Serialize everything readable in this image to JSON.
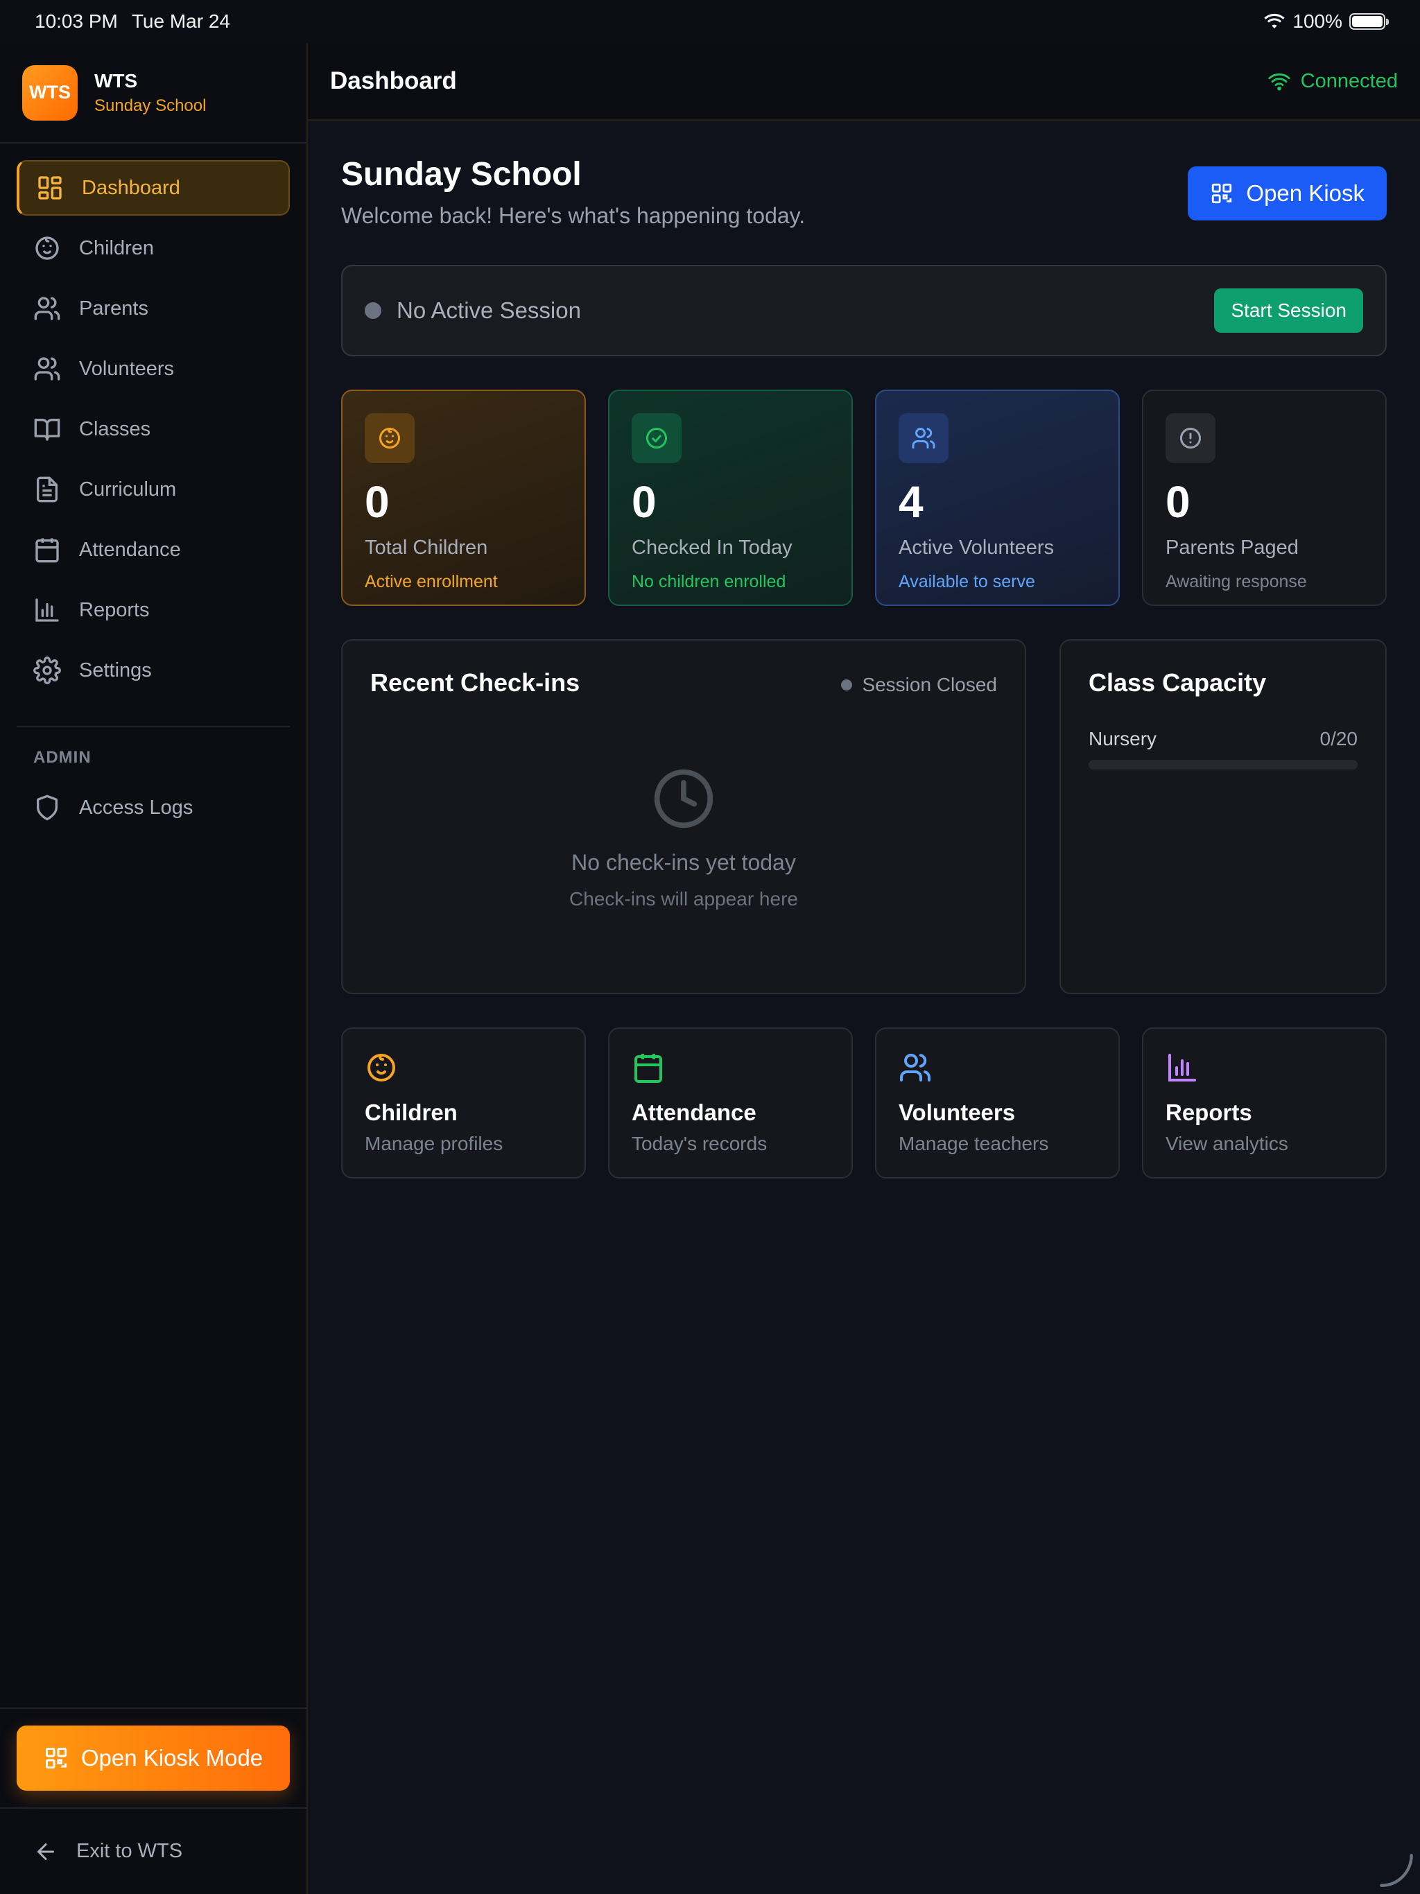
{
  "status_bar": {
    "time": "10:03 PM",
    "date": "Tue Mar 24",
    "battery": "100%"
  },
  "brand": {
    "logo_text": "WTS",
    "name": "WTS",
    "subtitle": "Sunday School"
  },
  "sidebar": {
    "items": [
      {
        "label": "Dashboard",
        "icon": "dashboard-icon",
        "active": true
      },
      {
        "label": "Children",
        "icon": "baby-icon"
      },
      {
        "label": "Parents",
        "icon": "users-icon"
      },
      {
        "label": "Volunteers",
        "icon": "users-icon"
      },
      {
        "label": "Classes",
        "icon": "book-icon"
      },
      {
        "label": "Curriculum",
        "icon": "document-icon"
      },
      {
        "label": "Attendance",
        "icon": "calendar-icon"
      },
      {
        "label": "Reports",
        "icon": "bar-chart-icon"
      },
      {
        "label": "Settings",
        "icon": "gear-icon"
      }
    ],
    "admin_label": "ADMIN",
    "admin_items": [
      {
        "label": "Access Logs",
        "icon": "shield-icon"
      }
    ],
    "kiosk_button": "Open Kiosk Mode",
    "exit": "Exit to WTS"
  },
  "header": {
    "title": "Dashboard",
    "connection": "Connected"
  },
  "main": {
    "title": "Sunday School",
    "subtitle": "Welcome back! Here's what's happening today.",
    "open_kiosk": "Open Kiosk",
    "session": {
      "status": "No Active Session",
      "button": "Start Session"
    },
    "stats": [
      {
        "value": "0",
        "label": "Total Children",
        "sub": "Active enrollment",
        "color": "#f5a524"
      },
      {
        "value": "0",
        "label": "Checked In Today",
        "sub": "No children enrolled",
        "color": "#22c55e"
      },
      {
        "value": "4",
        "label": "Active Volunteers",
        "sub": "Available to serve",
        "color": "#60a5fa"
      },
      {
        "value": "0",
        "label": "Parents Paged",
        "sub": "Awaiting response",
        "color": "#9ca3af"
      }
    ],
    "recent": {
      "title": "Recent Check-ins",
      "session_state": "Session Closed",
      "empty_title": "No check-ins yet today",
      "empty_sub": "Check-ins will appear here"
    },
    "capacity": {
      "title": "Class Capacity",
      "classes": [
        {
          "name": "Nursery",
          "value": "0/20",
          "fraction": 0
        }
      ]
    },
    "quick_links": [
      {
        "title": "Children",
        "sub": "Manage profiles",
        "color": "#f5a524"
      },
      {
        "title": "Attendance",
        "sub": "Today's records",
        "color": "#22c55e"
      },
      {
        "title": "Volunteers",
        "sub": "Manage teachers",
        "color": "#60a5fa"
      },
      {
        "title": "Reports",
        "sub": "View analytics",
        "color": "#c084fc"
      }
    ]
  }
}
